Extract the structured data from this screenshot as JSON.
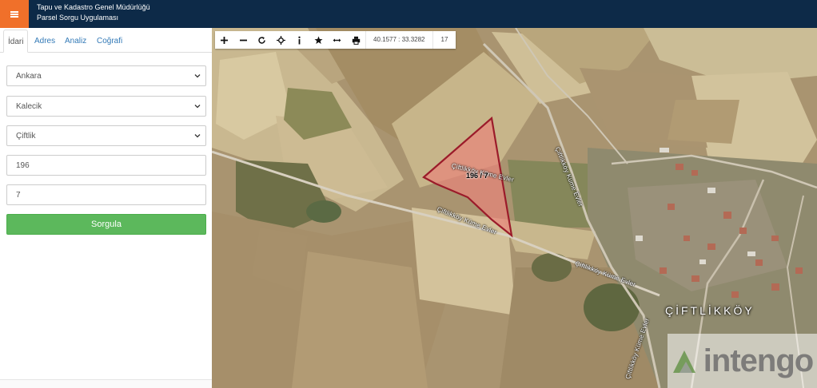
{
  "header": {
    "menu_icon": "hamburger-menu-icon",
    "title_line1": "Tapu ve Kadastro Genel Müdürlüğü",
    "title_line2": "Parsel Sorgu Uygulaması",
    "colors": {
      "header_bg": "#0d2a48",
      "menu_bg": "#f0702a"
    }
  },
  "sidebar": {
    "tabs": [
      {
        "label": "İdari",
        "active": true
      },
      {
        "label": "Adres",
        "active": false
      },
      {
        "label": "Analiz",
        "active": false
      },
      {
        "label": "Coğrafi",
        "active": false
      }
    ],
    "form": {
      "il": "Ankara",
      "ilce": "Kalecik",
      "mahalle": "Çiftlik",
      "ada": "196",
      "parsel": "7"
    },
    "submit_label": "Sorgula",
    "colors": {
      "submit": "#5cb85c",
      "tab_link": "#337ab7"
    }
  },
  "map": {
    "toolbar": {
      "tools": [
        "zoom-in-icon",
        "zoom-out-icon",
        "refresh-icon",
        "locate-icon",
        "info-icon",
        "star-icon",
        "measure-icon",
        "print-icon"
      ],
      "coordinates": "40.1577 : 33.3282",
      "zoom_level": "17"
    },
    "parcel_label": "196 / 7",
    "road_labels": [
      "Çiftlikköy Küme Evler",
      "Çiftlikköy Küme Evler",
      "Çiftlikköy Küme Evler",
      "Çiftlikköy Küme Evler",
      "Çiftlikköy Küme Evler"
    ],
    "village_label": "ÇİFTLİKKÖY",
    "watermark": "intengo",
    "colors": {
      "parcel_fill": "#e8857a",
      "parcel_stroke": "#9b1b2a"
    }
  }
}
